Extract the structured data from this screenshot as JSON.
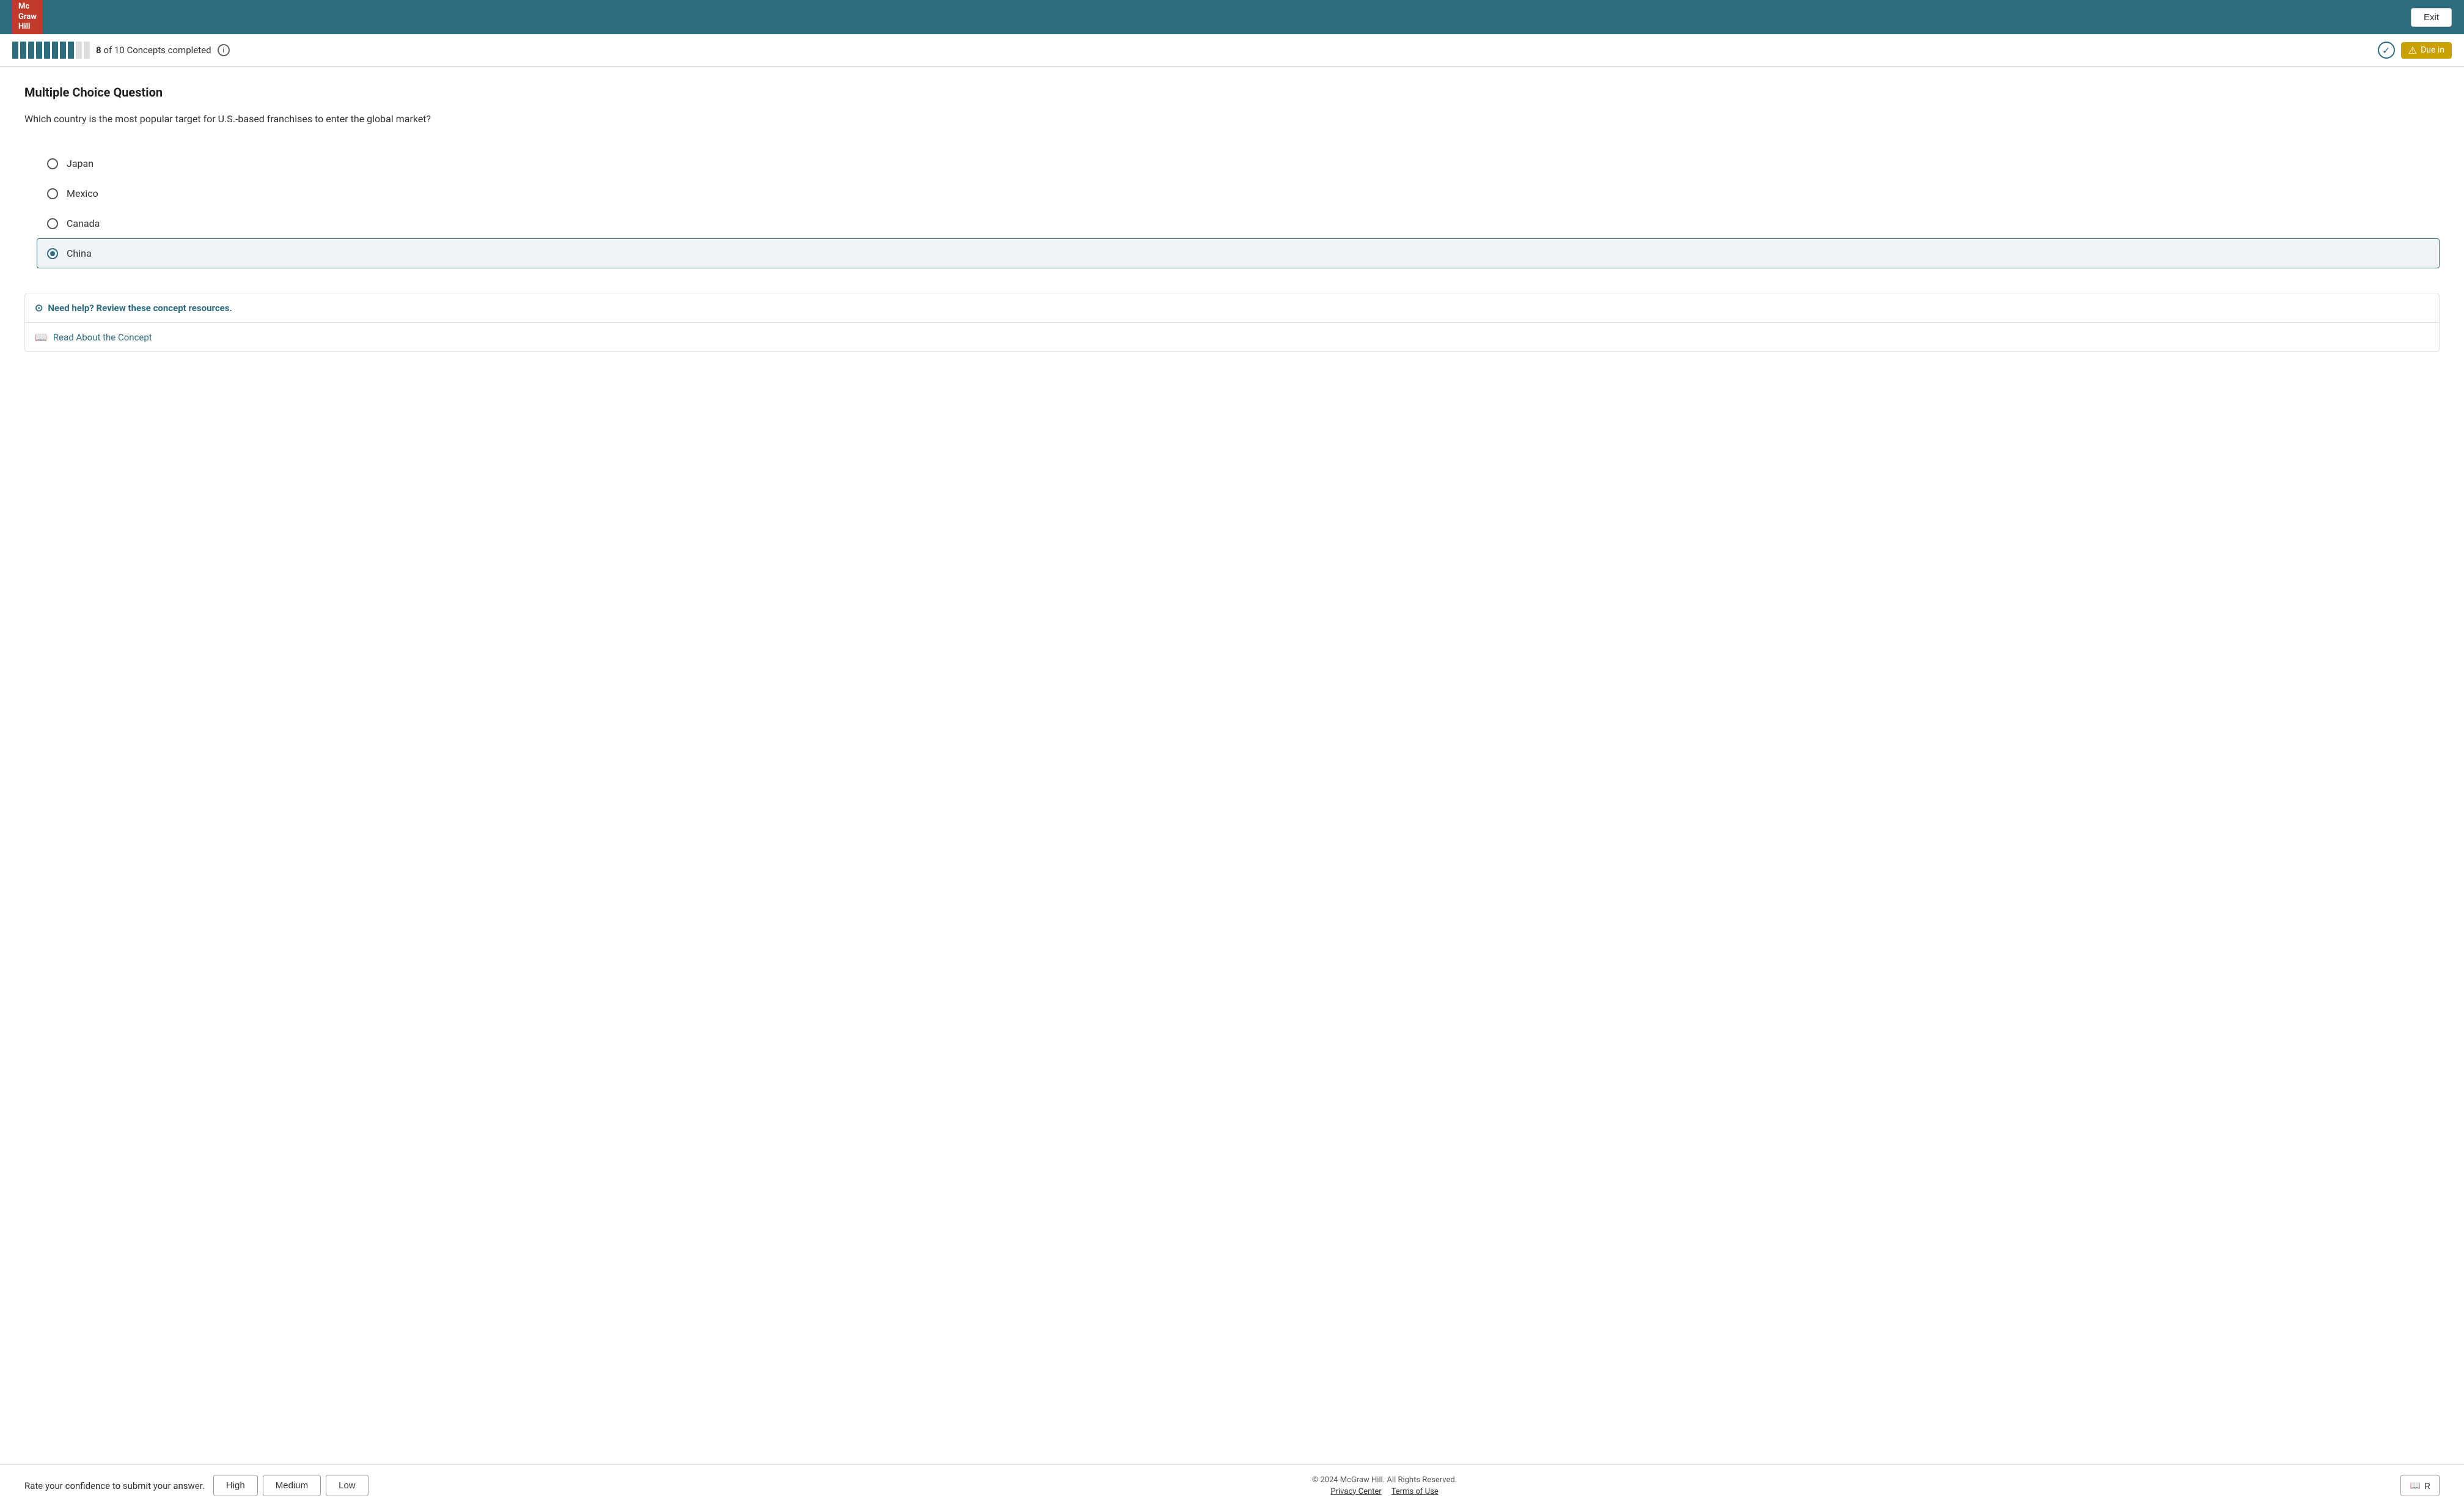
{
  "nav": {
    "logo_line1": "Mc",
    "logo_line2": "Graw",
    "logo_line3": "Hill",
    "exit_label": "Exit"
  },
  "progress": {
    "current": 8,
    "total": 10,
    "label": "of 10",
    "suffix": "Concepts completed",
    "info_label": "i",
    "total_segments": 10,
    "filled_segments": 8,
    "due_label": "Due in"
  },
  "question": {
    "type_label": "Multiple Choice Question",
    "text": "Which country is the most popular target for U.S.-based franchises to enter the global market?",
    "options": [
      {
        "id": "japan",
        "label": "Japan"
      },
      {
        "id": "mexico",
        "label": "Mexico"
      },
      {
        "id": "canada",
        "label": "Canada"
      },
      {
        "id": "china",
        "label": "China"
      }
    ],
    "selected_option": "china"
  },
  "help": {
    "header_label": "Need help? Review these concept resources.",
    "read_label": "Read About the Concept"
  },
  "footer": {
    "confidence_prompt": "Rate your confidence to submit your answer.",
    "high_label": "High",
    "medium_label": "Medium",
    "low_label": "Low",
    "copyright": "© 2024 McGraw Hill. All Rights Reserved.",
    "privacy_label": "Privacy Center",
    "terms_label": "Terms of Use",
    "read_concept_label": "R"
  }
}
